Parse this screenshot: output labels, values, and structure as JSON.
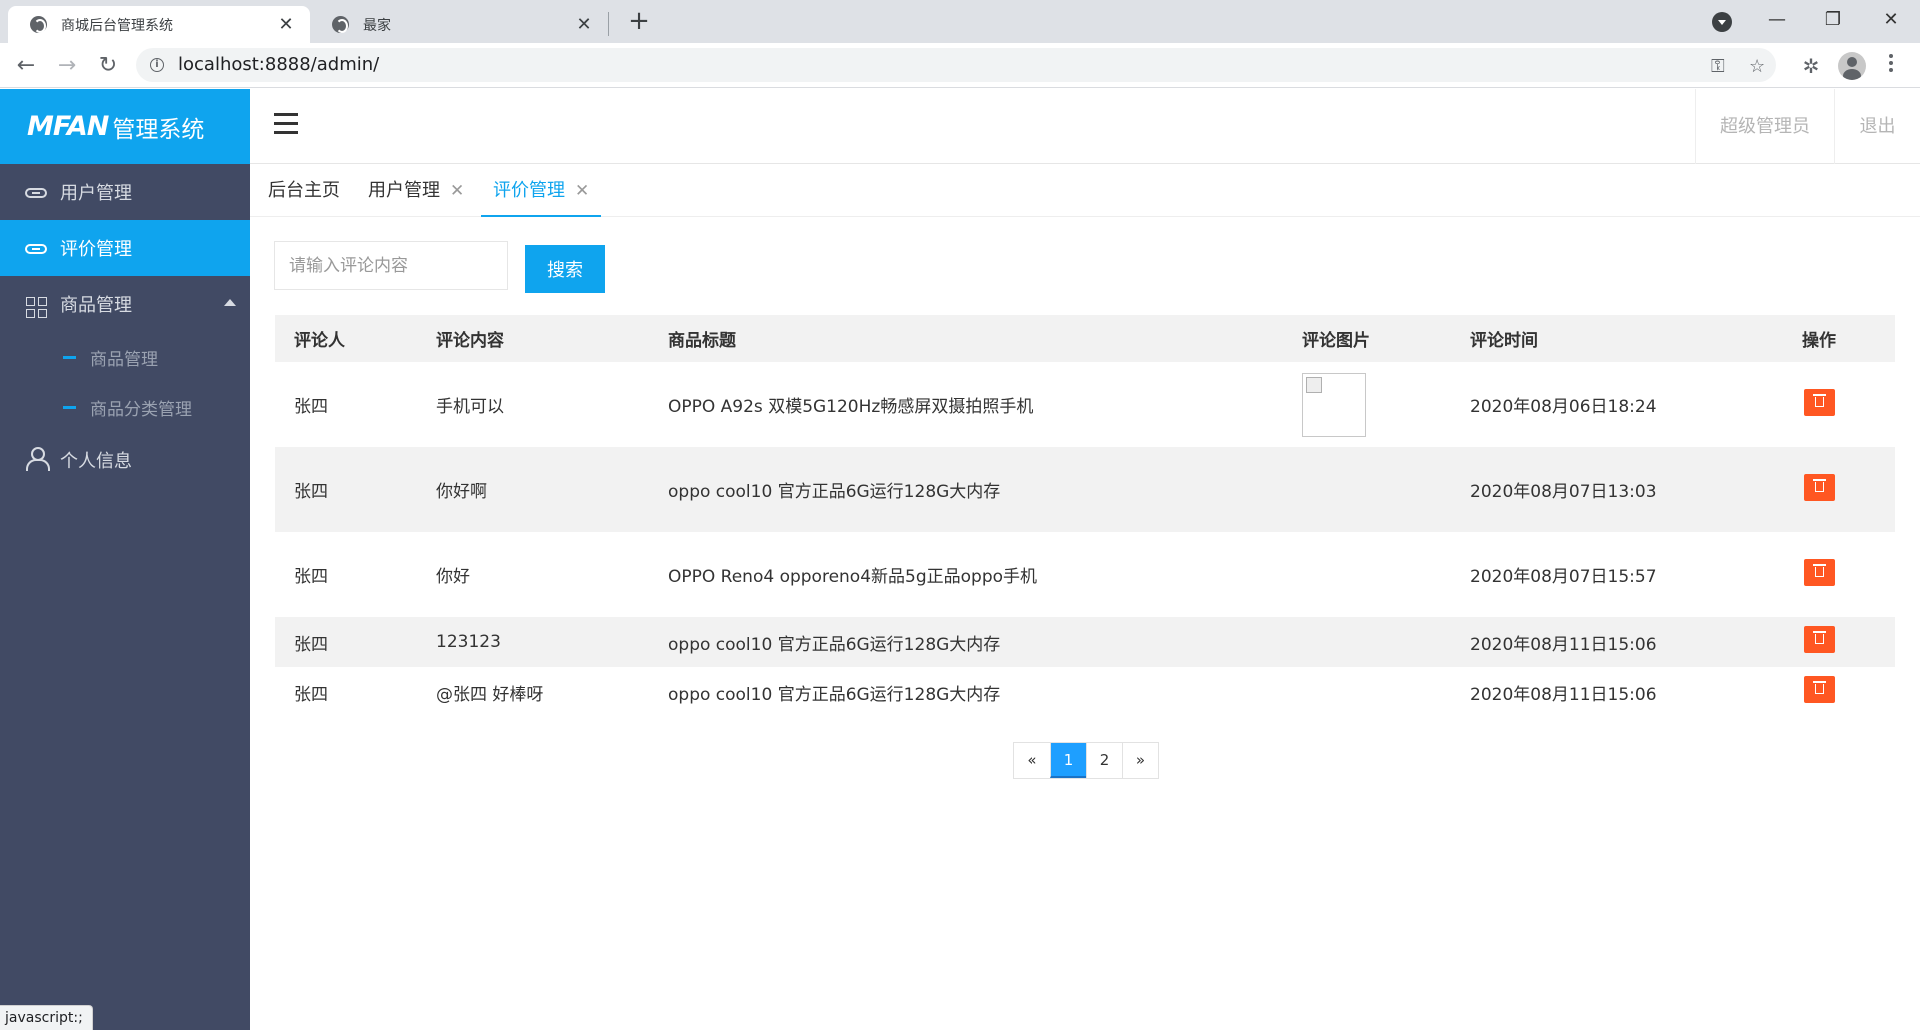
{
  "browser": {
    "tabs": [
      {
        "title": "商城后台管理系统",
        "active": true
      },
      {
        "title": "最家",
        "active": false
      }
    ],
    "url": "localhost:8888/admin/",
    "status_tip": "javascript:;"
  },
  "app": {
    "logo_mark": "MFAN",
    "logo_text": "管理系统",
    "header": {
      "admin_label": "超级管理员",
      "logout_label": "退出"
    }
  },
  "sidebar": {
    "items": [
      {
        "label": "用户管理",
        "icon": "link-icon"
      },
      {
        "label": "评价管理",
        "icon": "link-icon",
        "active": true
      },
      {
        "label": "商品管理",
        "icon": "grid-icon",
        "expanded": true
      },
      {
        "label": "个人信息",
        "icon": "user-icon"
      }
    ],
    "sub_items": [
      {
        "label": "商品管理"
      },
      {
        "label": "商品分类管理"
      }
    ]
  },
  "page_tabs": [
    {
      "label": "后台主页"
    },
    {
      "label": "用户管理"
    },
    {
      "label": "评价管理",
      "active": true
    }
  ],
  "search": {
    "placeholder": "请输入评论内容",
    "button_label": "搜索"
  },
  "table": {
    "columns": [
      "评论人",
      "评论内容",
      "商品标题",
      "评论图片",
      "评论时间",
      "操作"
    ],
    "rows": [
      {
        "user": "张四",
        "content": "手机可以",
        "title": "OPPO A92s 双模5G120Hz畅感屏双摄拍照手机",
        "has_image": true,
        "time": "2020年08月06日18:24"
      },
      {
        "user": "张四",
        "content": "你好啊",
        "title": "oppo cool10 官方正品6G运行128G大内存",
        "has_image": false,
        "time": "2020年08月07日13:03"
      },
      {
        "user": "张四",
        "content": "你好",
        "title": "OPPO Reno4 opporeno4新品5g正品oppo手机",
        "has_image": false,
        "time": "2020年08月07日15:57"
      },
      {
        "user": "张四",
        "content": "123123",
        "title": "oppo cool10 官方正品6G运行128G大内存",
        "has_image": false,
        "time": "2020年08月11日15:06"
      },
      {
        "user": "张四",
        "content": "@张四 好棒呀",
        "title": "oppo cool10 官方正品6G运行128G大内存",
        "has_image": false,
        "time": "2020年08月11日15:06"
      }
    ]
  },
  "pagination": {
    "prev": "«",
    "pages": [
      "1",
      "2"
    ],
    "current": "1",
    "next": "»"
  },
  "colors": {
    "accent": "#0fa4ee",
    "sidebar_bg": "#414a64",
    "danger": "#ff5722",
    "page_active": "#1e9fff"
  }
}
